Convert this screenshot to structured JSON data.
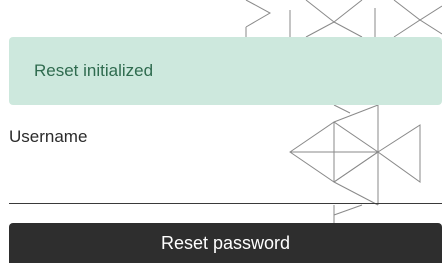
{
  "alert": {
    "message": "Reset initialized",
    "background_color": "#cde8dd",
    "text_color": "#2f6b4f"
  },
  "form": {
    "username_label": "Username",
    "username_value": ""
  },
  "actions": {
    "reset_button_label": "Reset password",
    "button_color": "#2e2e2e"
  }
}
